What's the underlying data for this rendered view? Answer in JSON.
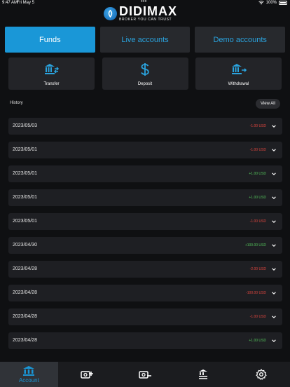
{
  "status": {
    "time": "9:47 AM",
    "date": "Fri May 5",
    "battery": "100%",
    "dots": "•••"
  },
  "brand": {
    "name": "DIDIMAX",
    "tagline": "BROKER YOU CAN TRUST"
  },
  "tabs": [
    {
      "label": "Funds",
      "active": true
    },
    {
      "label": "Live accounts",
      "active": false
    },
    {
      "label": "Demo accounts",
      "active": false
    }
  ],
  "actions": [
    {
      "label": "Transfer",
      "icon": "bank-transfer-icon"
    },
    {
      "label": "Deposit",
      "icon": "dollar-icon"
    },
    {
      "label": "Withdrawal",
      "icon": "bank-withdrawal-icon"
    }
  ],
  "history": {
    "title": "History",
    "view_all": "View All",
    "rows": [
      {
        "date": "2023/05/03",
        "amount": "-1.00 USD",
        "sign": "neg"
      },
      {
        "date": "2023/05/01",
        "amount": "-1.00 USD",
        "sign": "neg"
      },
      {
        "date": "2023/05/01",
        "amount": "+1.00 USD",
        "sign": "pos"
      },
      {
        "date": "2023/05/01",
        "amount": "+1.00 USD",
        "sign": "pos"
      },
      {
        "date": "2023/05/01",
        "amount": "-1.00 USD",
        "sign": "neg"
      },
      {
        "date": "2023/04/30",
        "amount": "+100.00 USD",
        "sign": "pos"
      },
      {
        "date": "2023/04/28",
        "amount": "-2.00 USD",
        "sign": "neg"
      },
      {
        "date": "2023/04/28",
        "amount": "-100.00 USD",
        "sign": "neg"
      },
      {
        "date": "2023/04/28",
        "amount": "-1.00 USD",
        "sign": "neg"
      },
      {
        "date": "2023/04/28",
        "amount": "+1.00 USD",
        "sign": "pos"
      }
    ]
  },
  "tabbar": {
    "account_label": "Account",
    "items": [
      "account-icon",
      "deposit-icon",
      "withdraw-icon",
      "transfer-icon",
      "settings-icon"
    ]
  },
  "colors": {
    "accent": "#1a97d7",
    "negative": "#e0463f",
    "positive": "#53c15a",
    "background": "#0f1012",
    "card": "#1e1f23"
  }
}
